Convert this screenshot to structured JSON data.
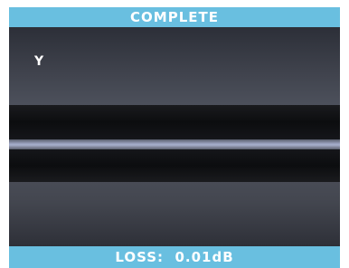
{
  "header": {
    "status": "COMPLETE"
  },
  "view": {
    "axis_label": "Y"
  },
  "footer": {
    "loss_label": "LOSS:",
    "loss_value": "0.01dB"
  },
  "colors": {
    "bar": "#69bfe0",
    "text": "#ffffff",
    "background": "#3a3d47"
  }
}
